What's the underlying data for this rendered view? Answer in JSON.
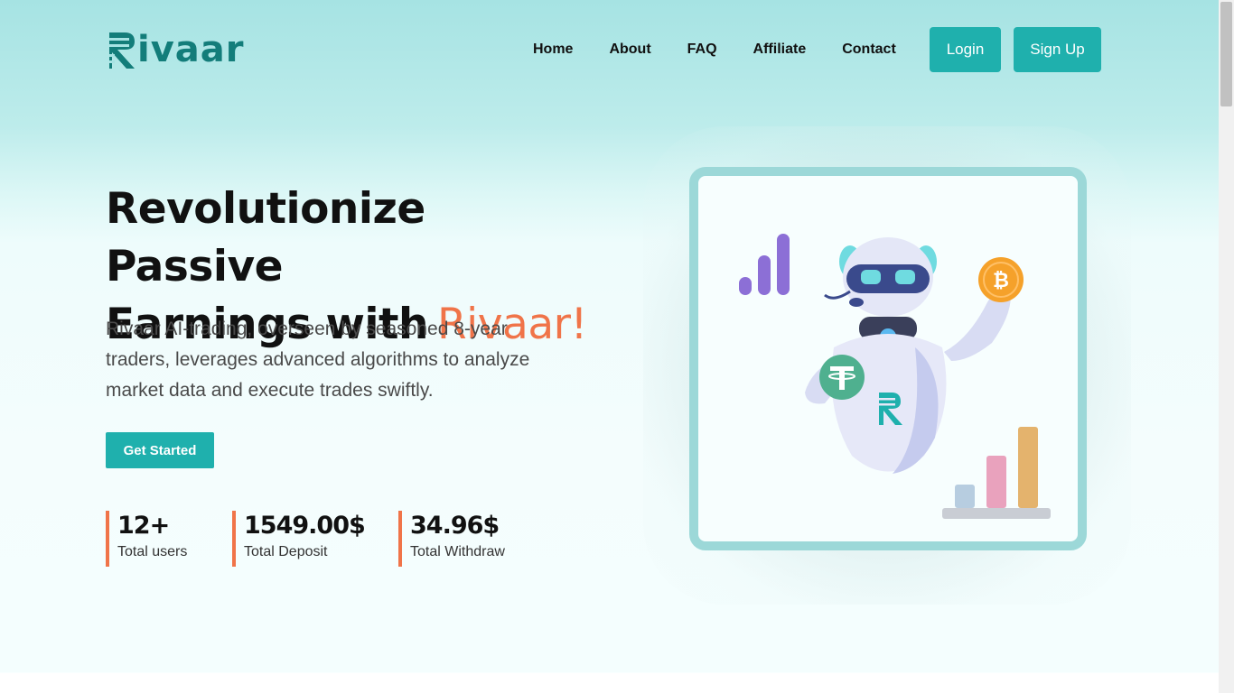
{
  "brand": {
    "name": "ivaar",
    "logo_letter": "R"
  },
  "nav": {
    "items": [
      {
        "label": "Home"
      },
      {
        "label": "About"
      },
      {
        "label": "FAQ"
      },
      {
        "label": "Affiliate"
      },
      {
        "label": "Contact"
      }
    ],
    "login_label": "Login",
    "signup_label": "Sign Up"
  },
  "hero": {
    "title_line1": "Revolutionize Passive",
    "title_line2": "Earnings with",
    "title_accent": "Rivaar!",
    "description": "Rivaar AI-trading, overseen by seasoned 8-year traders, leverages advanced algorithms to analyze market data and execute trades swiftly.",
    "cta_label": "Get Started"
  },
  "stats": [
    {
      "value": "12+",
      "label": "Total users"
    },
    {
      "value": "1549.00$",
      "label": "Total Deposit"
    },
    {
      "value": "34.96$",
      "label": "Total Withdraw"
    }
  ],
  "colors": {
    "primary": "#1fb0ad",
    "accent": "#f07449",
    "brand_dark": "#137d7a"
  },
  "illustration": {
    "icons": [
      "robot-icon",
      "bitcoin-icon",
      "tether-icon",
      "bar-chart-icon"
    ]
  }
}
